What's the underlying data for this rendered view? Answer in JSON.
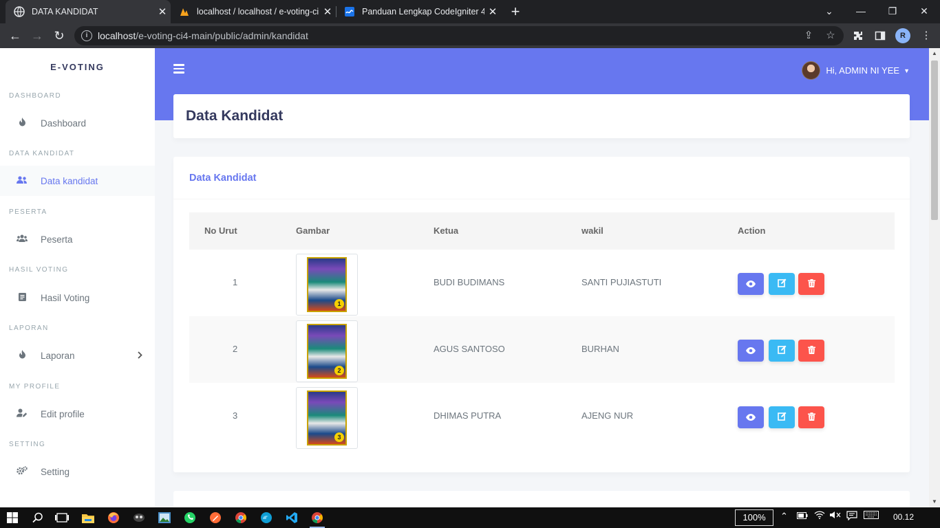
{
  "browser": {
    "tabs": [
      {
        "title": "DATA KANDIDAT",
        "active": true
      },
      {
        "title": "localhost / localhost / e-voting-ci",
        "active": false
      },
      {
        "title": "Panduan Lengkap CodeIgniter 4",
        "active": false
      }
    ],
    "url_host": "localhost",
    "url_path": "/e-voting-ci4-main/public/admin/kandidat",
    "profile_initial": "R"
  },
  "sidebar": {
    "brand": "E-VOTING",
    "sections": [
      {
        "header": "DASHBOARD",
        "item": "Dashboard",
        "icon": "fire-icon"
      },
      {
        "header": "DATA KANDIDAT",
        "item": "Data kandidat",
        "icon": "users-icon"
      },
      {
        "header": "PESERTA",
        "item": "Peserta",
        "icon": "users-group-icon"
      },
      {
        "header": "HASIL VOTING",
        "item": "Hasil Voting",
        "icon": "document-icon"
      },
      {
        "header": "LAPORAN",
        "item": "Laporan",
        "icon": "fire-icon"
      },
      {
        "header": "MY PROFILE",
        "item": "Edit profile",
        "icon": "user-edit-icon"
      },
      {
        "header": "SETTING",
        "item": "Setting",
        "icon": "cogs-icon"
      }
    ]
  },
  "topbar": {
    "greeting": "Hi, ADMIN NI YEE"
  },
  "page": {
    "title": "Data Kandidat",
    "card_title": "Data Kandidat",
    "columns": [
      "No Urut",
      "Gambar",
      "Ketua",
      "wakil",
      "Action"
    ],
    "rows": [
      {
        "no": "1",
        "ketua": "BUDI BUDIMANS",
        "wakil": "SANTI PUJIASTUTI"
      },
      {
        "no": "2",
        "ketua": "AGUS SANTOSO",
        "wakil": "BURHAN"
      },
      {
        "no": "3",
        "ketua": "DHIMAS PUTRA",
        "wakil": "AJENG NUR"
      }
    ]
  },
  "taskbar": {
    "zoom": "100%",
    "time": "00.12"
  },
  "colors": {
    "primary": "#6777ef",
    "info": "#3abaf4",
    "danger": "#fc544b"
  }
}
